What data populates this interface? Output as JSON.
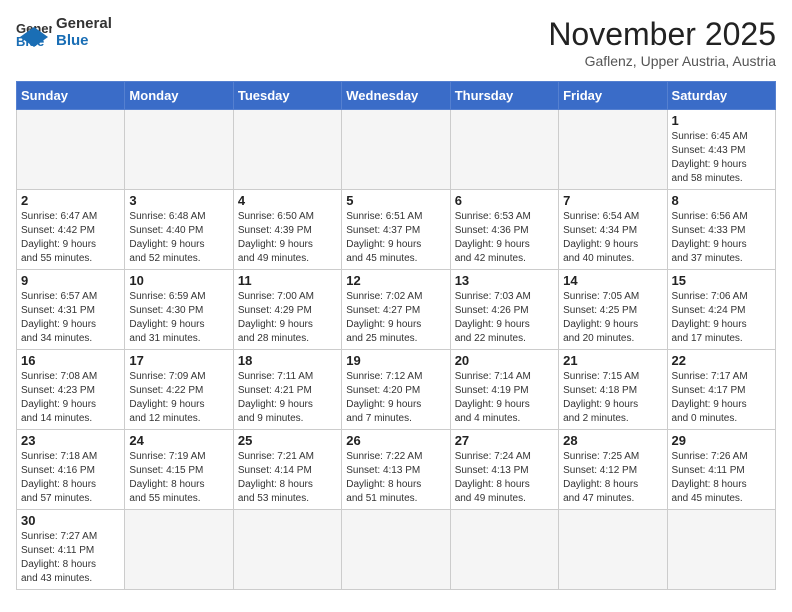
{
  "header": {
    "logo_general": "General",
    "logo_blue": "Blue",
    "month": "November 2025",
    "location": "Gaflenz, Upper Austria, Austria"
  },
  "weekdays": [
    "Sunday",
    "Monday",
    "Tuesday",
    "Wednesday",
    "Thursday",
    "Friday",
    "Saturday"
  ],
  "weeks": [
    [
      {
        "day": "",
        "info": ""
      },
      {
        "day": "",
        "info": ""
      },
      {
        "day": "",
        "info": ""
      },
      {
        "day": "",
        "info": ""
      },
      {
        "day": "",
        "info": ""
      },
      {
        "day": "",
        "info": ""
      },
      {
        "day": "1",
        "info": "Sunrise: 6:45 AM\nSunset: 4:43 PM\nDaylight: 9 hours\nand 58 minutes."
      }
    ],
    [
      {
        "day": "2",
        "info": "Sunrise: 6:47 AM\nSunset: 4:42 PM\nDaylight: 9 hours\nand 55 minutes."
      },
      {
        "day": "3",
        "info": "Sunrise: 6:48 AM\nSunset: 4:40 PM\nDaylight: 9 hours\nand 52 minutes."
      },
      {
        "day": "4",
        "info": "Sunrise: 6:50 AM\nSunset: 4:39 PM\nDaylight: 9 hours\nand 49 minutes."
      },
      {
        "day": "5",
        "info": "Sunrise: 6:51 AM\nSunset: 4:37 PM\nDaylight: 9 hours\nand 45 minutes."
      },
      {
        "day": "6",
        "info": "Sunrise: 6:53 AM\nSunset: 4:36 PM\nDaylight: 9 hours\nand 42 minutes."
      },
      {
        "day": "7",
        "info": "Sunrise: 6:54 AM\nSunset: 4:34 PM\nDaylight: 9 hours\nand 40 minutes."
      },
      {
        "day": "8",
        "info": "Sunrise: 6:56 AM\nSunset: 4:33 PM\nDaylight: 9 hours\nand 37 minutes."
      }
    ],
    [
      {
        "day": "9",
        "info": "Sunrise: 6:57 AM\nSunset: 4:31 PM\nDaylight: 9 hours\nand 34 minutes."
      },
      {
        "day": "10",
        "info": "Sunrise: 6:59 AM\nSunset: 4:30 PM\nDaylight: 9 hours\nand 31 minutes."
      },
      {
        "day": "11",
        "info": "Sunrise: 7:00 AM\nSunset: 4:29 PM\nDaylight: 9 hours\nand 28 minutes."
      },
      {
        "day": "12",
        "info": "Sunrise: 7:02 AM\nSunset: 4:27 PM\nDaylight: 9 hours\nand 25 minutes."
      },
      {
        "day": "13",
        "info": "Sunrise: 7:03 AM\nSunset: 4:26 PM\nDaylight: 9 hours\nand 22 minutes."
      },
      {
        "day": "14",
        "info": "Sunrise: 7:05 AM\nSunset: 4:25 PM\nDaylight: 9 hours\nand 20 minutes."
      },
      {
        "day": "15",
        "info": "Sunrise: 7:06 AM\nSunset: 4:24 PM\nDaylight: 9 hours\nand 17 minutes."
      }
    ],
    [
      {
        "day": "16",
        "info": "Sunrise: 7:08 AM\nSunset: 4:23 PM\nDaylight: 9 hours\nand 14 minutes."
      },
      {
        "day": "17",
        "info": "Sunrise: 7:09 AM\nSunset: 4:22 PM\nDaylight: 9 hours\nand 12 minutes."
      },
      {
        "day": "18",
        "info": "Sunrise: 7:11 AM\nSunset: 4:21 PM\nDaylight: 9 hours\nand 9 minutes."
      },
      {
        "day": "19",
        "info": "Sunrise: 7:12 AM\nSunset: 4:20 PM\nDaylight: 9 hours\nand 7 minutes."
      },
      {
        "day": "20",
        "info": "Sunrise: 7:14 AM\nSunset: 4:19 PM\nDaylight: 9 hours\nand 4 minutes."
      },
      {
        "day": "21",
        "info": "Sunrise: 7:15 AM\nSunset: 4:18 PM\nDaylight: 9 hours\nand 2 minutes."
      },
      {
        "day": "22",
        "info": "Sunrise: 7:17 AM\nSunset: 4:17 PM\nDaylight: 9 hours\nand 0 minutes."
      }
    ],
    [
      {
        "day": "23",
        "info": "Sunrise: 7:18 AM\nSunset: 4:16 PM\nDaylight: 8 hours\nand 57 minutes."
      },
      {
        "day": "24",
        "info": "Sunrise: 7:19 AM\nSunset: 4:15 PM\nDaylight: 8 hours\nand 55 minutes."
      },
      {
        "day": "25",
        "info": "Sunrise: 7:21 AM\nSunset: 4:14 PM\nDaylight: 8 hours\nand 53 minutes."
      },
      {
        "day": "26",
        "info": "Sunrise: 7:22 AM\nSunset: 4:13 PM\nDaylight: 8 hours\nand 51 minutes."
      },
      {
        "day": "27",
        "info": "Sunrise: 7:24 AM\nSunset: 4:13 PM\nDaylight: 8 hours\nand 49 minutes."
      },
      {
        "day": "28",
        "info": "Sunrise: 7:25 AM\nSunset: 4:12 PM\nDaylight: 8 hours\nand 47 minutes."
      },
      {
        "day": "29",
        "info": "Sunrise: 7:26 AM\nSunset: 4:11 PM\nDaylight: 8 hours\nand 45 minutes."
      }
    ],
    [
      {
        "day": "30",
        "info": "Sunrise: 7:27 AM\nSunset: 4:11 PM\nDaylight: 8 hours\nand 43 minutes."
      },
      {
        "day": "",
        "info": ""
      },
      {
        "day": "",
        "info": ""
      },
      {
        "day": "",
        "info": ""
      },
      {
        "day": "",
        "info": ""
      },
      {
        "day": "",
        "info": ""
      },
      {
        "day": "",
        "info": ""
      }
    ]
  ]
}
